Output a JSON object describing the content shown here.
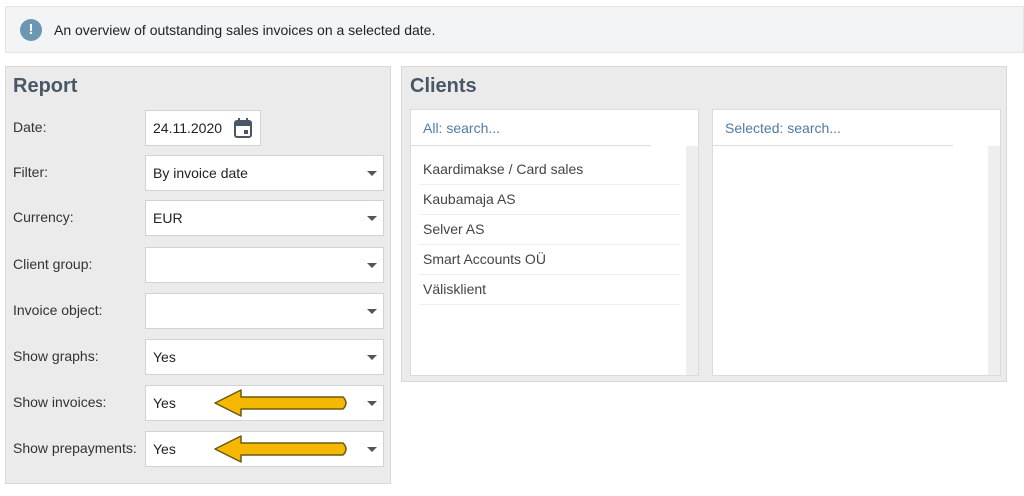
{
  "info": {
    "icon": "info-icon",
    "icon_glyph": "!",
    "text": "An overview of outstanding sales invoices on a selected date."
  },
  "report": {
    "title": "Report",
    "fields": [
      {
        "label": "Date:",
        "value": "24.11.2020",
        "type": "date",
        "icon": "calendar-icon"
      },
      {
        "label": "Filter:",
        "value": "By invoice date",
        "type": "select"
      },
      {
        "label": "Currency:",
        "value": "EUR",
        "type": "select"
      },
      {
        "label": "Client group:",
        "value": "",
        "type": "select"
      },
      {
        "label": "Invoice object:",
        "value": "",
        "type": "select"
      },
      {
        "label": "Show graphs:",
        "value": "Yes",
        "type": "select"
      },
      {
        "label": "Show invoices:",
        "value": "Yes",
        "type": "select",
        "highlight": "arrow-pointer-icon"
      },
      {
        "label": "Show prepayments:",
        "value": "Yes",
        "type": "select",
        "highlight": "arrow-pointer-icon"
      }
    ]
  },
  "clients": {
    "title": "Clients",
    "all": {
      "placeholder": "All: search...",
      "items": [
        "Kaardimakse / Card sales",
        "Kaubamaja AS",
        "Selver AS",
        "Smart Accounts OÜ",
        "Välisklient"
      ]
    },
    "selected": {
      "placeholder": "Selected: search...",
      "items": []
    }
  },
  "colors": {
    "accent": "#6b97b3",
    "panel_bg": "#ebebeb",
    "title": "#4a5866",
    "arrow": "#f5b800"
  }
}
